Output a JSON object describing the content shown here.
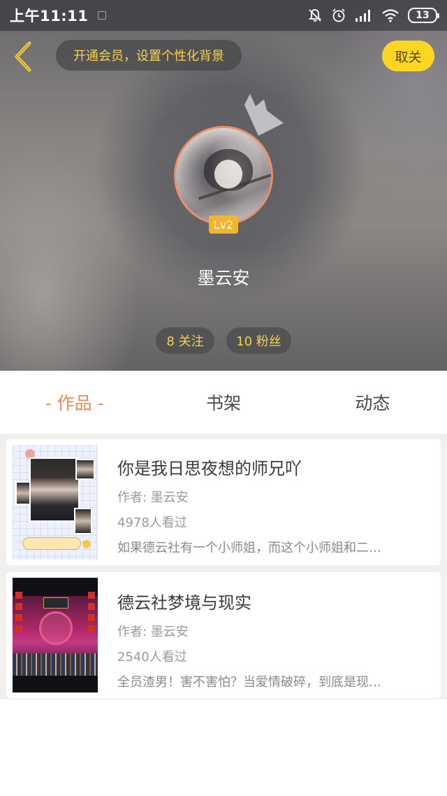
{
  "status_bar": {
    "time": "上午11:11",
    "battery": "13"
  },
  "top_bar": {
    "vip_prompt": "开通会员，设置个性化背景",
    "cancel_label": "取关"
  },
  "profile": {
    "level": "Lv2",
    "username": "墨云安",
    "following": "8 关注",
    "fans": "10 粉丝"
  },
  "tabs": [
    {
      "label": "- 作品 -",
      "active": true
    },
    {
      "label": "书架",
      "active": false
    },
    {
      "label": "动态",
      "active": false
    }
  ],
  "works": [
    {
      "title": "你是我日思夜想的师兄吖",
      "author": "作者: 墨云安",
      "views": "4978人看过",
      "description": "如果德云社有一个小师姐，而这个小师姐和二…"
    },
    {
      "title": "德云社梦境与现实",
      "author": "作者: 墨云安",
      "views": "2540人看过",
      "description": "全员渣男！害不害怕？当爱情破碎，到底是现…"
    }
  ],
  "colors": {
    "accent_tab": "#ec8a52",
    "vip_text": "#f6d24a",
    "cancel_button": "#fcd623",
    "level_badge": "#f1b530",
    "avatar_border": "#e8906a"
  }
}
